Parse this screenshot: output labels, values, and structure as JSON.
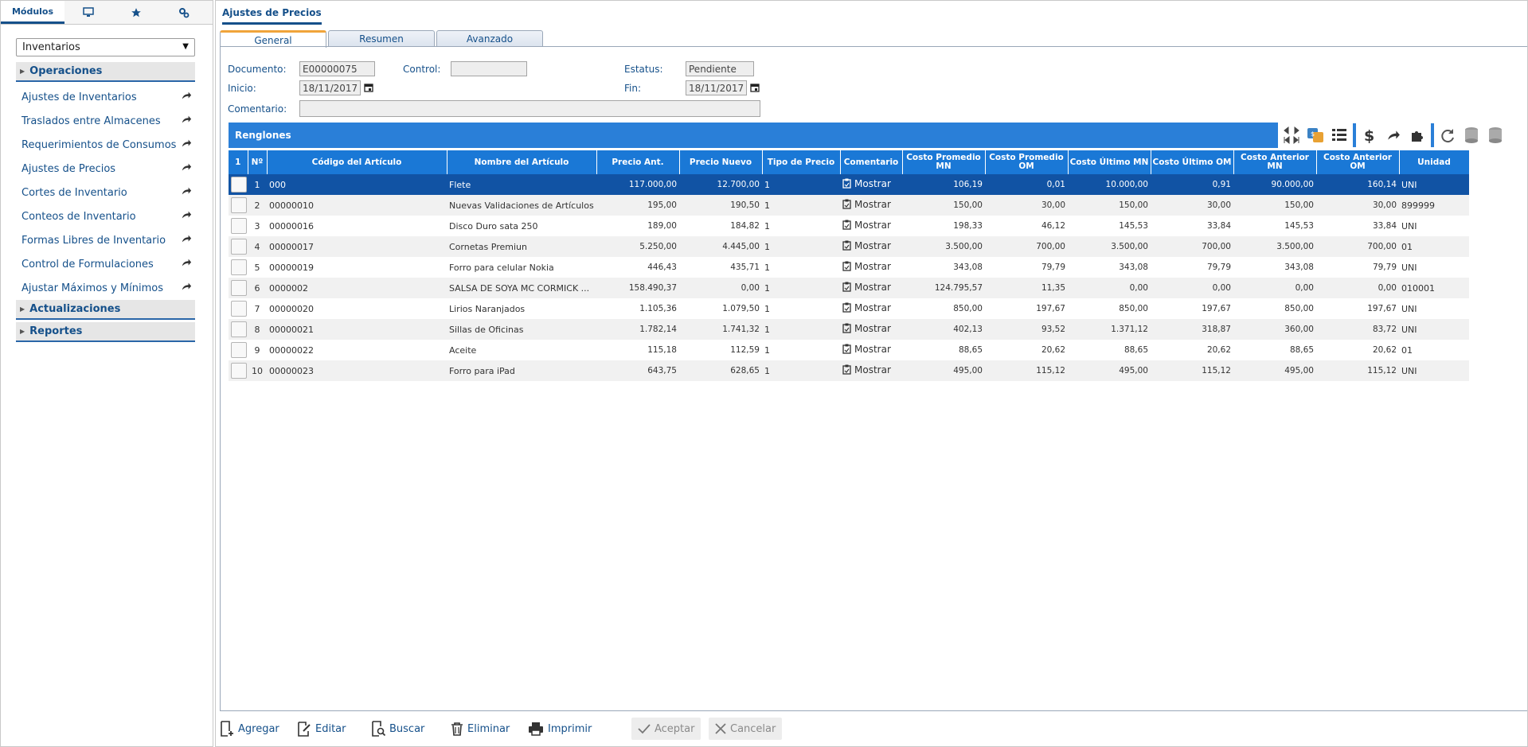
{
  "sidebar": {
    "tabs": [
      {
        "label": "Módulos"
      },
      {
        "icon": "monitor-icon"
      },
      {
        "icon": "star-icon"
      },
      {
        "icon": "settings-gears-icon"
      }
    ],
    "module_select": "Inventarios",
    "sections": [
      {
        "label": "Operaciones"
      },
      {
        "label": "Actualizaciones"
      },
      {
        "label": "Reportes"
      }
    ],
    "items": [
      {
        "label": "Ajustes de Inventarios"
      },
      {
        "label": "Traslados entre Almacenes"
      },
      {
        "label": "Requerimientos de Consumos"
      },
      {
        "label": "Ajustes de Precios"
      },
      {
        "label": "Cortes de Inventario"
      },
      {
        "label": "Conteos de Inventario"
      },
      {
        "label": "Formas Libres de Inventario"
      },
      {
        "label": "Control de Formulaciones"
      },
      {
        "label": "Ajustar Máximos y Mínimos"
      }
    ]
  },
  "main": {
    "title": "Ajustes de Precios",
    "tabs": [
      {
        "label": "General"
      },
      {
        "label": "Resumen"
      },
      {
        "label": "Avanzado"
      }
    ]
  },
  "form": {
    "documento_label": "Documento:",
    "documento_value": "E00000075",
    "control_label": "Control:",
    "control_value": "",
    "estatus_label": "Estatus:",
    "estatus_value": "Pendiente",
    "inicio_label": "Inicio:",
    "inicio_value": "18/11/2017",
    "fin_label": "Fin:",
    "fin_value": "18/11/2017",
    "comentario_label": "Comentario:",
    "comentario_value": ""
  },
  "grid": {
    "title": "Renglones",
    "columns": [
      "1",
      "Nº",
      "Código del Artículo",
      "Nombre del Artículo",
      "Precio Ant.",
      "Precio Nuevo",
      "Tipo de Precio",
      "Comentario",
      "Costo Promedio MN",
      "Costo Promedio OM",
      "Costo Último MN",
      "Costo Último OM",
      "Costo Anterior MN",
      "Costo Anterior OM",
      "Unidad"
    ],
    "rows": [
      {
        "n": "1",
        "codigo": "000",
        "nombre": "Flete",
        "precio_ant": "117.000,00",
        "precio_nuevo": "12.700,00",
        "tipo": "1",
        "comentario": "Mostrar",
        "cp_mn": "106,19",
        "cp_om": "0,01",
        "cu_mn": "10.000,00",
        "cu_om": "0,91",
        "ca_mn": "90.000,00",
        "ca_om": "160,14",
        "unidad": "UNI"
      },
      {
        "n": "2",
        "codigo": "00000010",
        "nombre": "Nuevas Validaciones de Artículos",
        "precio_ant": "195,00",
        "precio_nuevo": "190,50",
        "tipo": "1",
        "comentario": "Mostrar",
        "cp_mn": "150,00",
        "cp_om": "30,00",
        "cu_mn": "150,00",
        "cu_om": "30,00",
        "ca_mn": "150,00",
        "ca_om": "30,00",
        "unidad": "899999"
      },
      {
        "n": "3",
        "codigo": "00000016",
        "nombre": "Disco Duro sata 250",
        "precio_ant": "189,00",
        "precio_nuevo": "184,82",
        "tipo": "1",
        "comentario": "Mostrar",
        "cp_mn": "198,33",
        "cp_om": "46,12",
        "cu_mn": "145,53",
        "cu_om": "33,84",
        "ca_mn": "145,53",
        "ca_om": "33,84",
        "unidad": "UNI"
      },
      {
        "n": "4",
        "codigo": "00000017",
        "nombre": "Cornetas Premiun",
        "precio_ant": "5.250,00",
        "precio_nuevo": "4.445,00",
        "tipo": "1",
        "comentario": "Mostrar",
        "cp_mn": "3.500,00",
        "cp_om": "700,00",
        "cu_mn": "3.500,00",
        "cu_om": "700,00",
        "ca_mn": "3.500,00",
        "ca_om": "700,00",
        "unidad": "01"
      },
      {
        "n": "5",
        "codigo": "00000019",
        "nombre": "Forro para celular Nokia",
        "precio_ant": "446,43",
        "precio_nuevo": "435,71",
        "tipo": "1",
        "comentario": "Mostrar",
        "cp_mn": "343,08",
        "cp_om": "79,79",
        "cu_mn": "343,08",
        "cu_om": "79,79",
        "ca_mn": "343,08",
        "ca_om": "79,79",
        "unidad": "UNI"
      },
      {
        "n": "6",
        "codigo": "0000002",
        "nombre": "SALSA DE SOYA MC CORMICK ...",
        "precio_ant": "158.490,37",
        "precio_nuevo": "0,00",
        "tipo": "1",
        "comentario": "Mostrar",
        "cp_mn": "124.795,57",
        "cp_om": "11,35",
        "cu_mn": "0,00",
        "cu_om": "0,00",
        "ca_mn": "0,00",
        "ca_om": "0,00",
        "unidad": "010001"
      },
      {
        "n": "7",
        "codigo": "00000020",
        "nombre": "Lirios Naranjados",
        "precio_ant": "1.105,36",
        "precio_nuevo": "1.079,50",
        "tipo": "1",
        "comentario": "Mostrar",
        "cp_mn": "850,00",
        "cp_om": "197,67",
        "cu_mn": "850,00",
        "cu_om": "197,67",
        "ca_mn": "850,00",
        "ca_om": "197,67",
        "unidad": "UNI"
      },
      {
        "n": "8",
        "codigo": "00000021",
        "nombre": "Sillas de Oficinas",
        "precio_ant": "1.782,14",
        "precio_nuevo": "1.741,32",
        "tipo": "1",
        "comentario": "Mostrar",
        "cp_mn": "402,13",
        "cp_om": "93,52",
        "cu_mn": "1.371,12",
        "cu_om": "318,87",
        "ca_mn": "360,00",
        "ca_om": "83,72",
        "unidad": "UNI"
      },
      {
        "n": "9",
        "codigo": "00000022",
        "nombre": "Aceite",
        "precio_ant": "115,18",
        "precio_nuevo": "112,59",
        "tipo": "1",
        "comentario": "Mostrar",
        "cp_mn": "88,65",
        "cp_om": "20,62",
        "cu_mn": "88,65",
        "cu_om": "20,62",
        "ca_mn": "88,65",
        "ca_om": "20,62",
        "unidad": "01"
      },
      {
        "n": "10",
        "codigo": "00000023",
        "nombre": "Forro para iPad",
        "precio_ant": "643,75",
        "precio_nuevo": "628,65",
        "tipo": "1",
        "comentario": "Mostrar",
        "cp_mn": "495,00",
        "cp_om": "115,12",
        "cu_mn": "495,00",
        "cu_om": "115,12",
        "ca_mn": "495,00",
        "ca_om": "115,12",
        "unidad": "UNI"
      }
    ]
  },
  "actions": {
    "agregar": "Agregar",
    "editar": "Editar",
    "buscar": "Buscar",
    "eliminar": "Eliminar",
    "imprimir": "Imprimir",
    "aceptar": "Aceptar",
    "cancelar": "Cancelar"
  },
  "colors": {
    "accent": "#15508a",
    "grid_header": "#1a78d6",
    "selected_row": "#1153a4",
    "active_tab": "#f0a43a"
  }
}
